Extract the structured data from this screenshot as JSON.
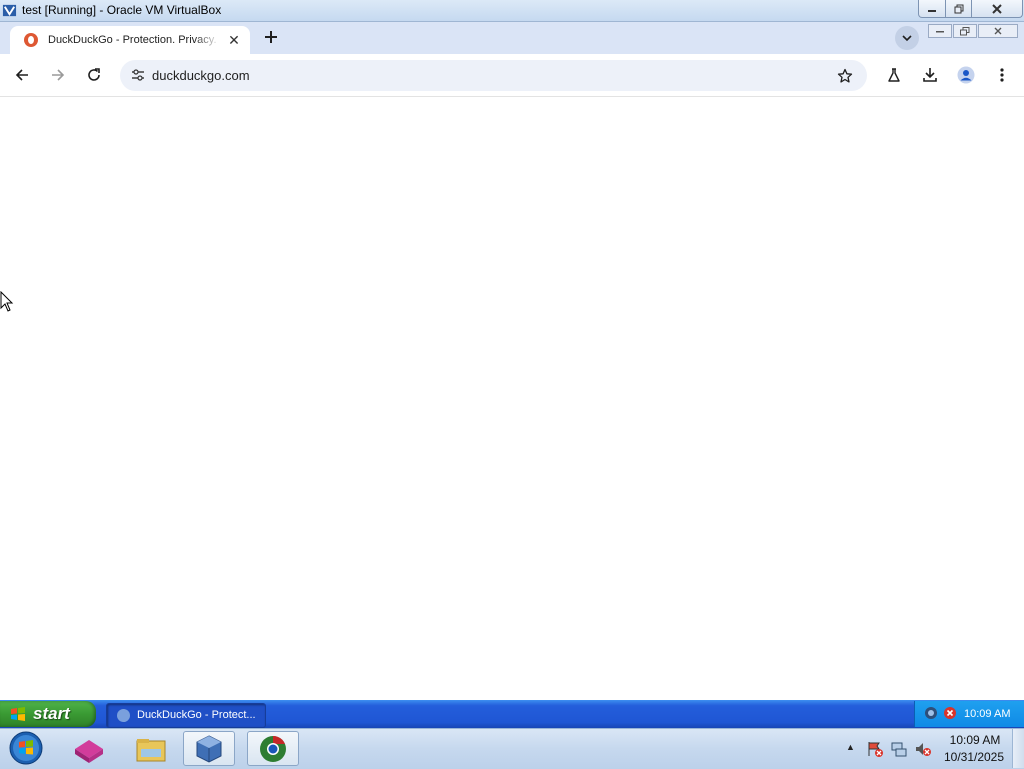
{
  "host_window": {
    "title": "test [Running] - Oracle VM VirtualBox"
  },
  "browser": {
    "tab": {
      "title": "DuckDuckGo - Protection. Privacy. Peace of mind.",
      "favicon": "duckduckgo-icon"
    },
    "url": "duckduckgo.com",
    "toolbar_icons": [
      "back-icon",
      "forward-icon",
      "reload-icon",
      "site-info-icon",
      "bookmark-star-icon",
      "labs-flask-icon",
      "download-icon",
      "profile-icon",
      "menu-icon"
    ]
  },
  "guest_taskbar": {
    "start_label": "start",
    "task_label": "DuckDuckGo - Protect...",
    "clock": "10:09 AM"
  },
  "host_taskbar": {
    "time": "10:09 AM",
    "date": "10/31/2025",
    "pinned": [
      "windows-start-orb",
      "app-icon-pink-box",
      "file-explorer-icon",
      "virtualbox-icon",
      "chrome-icon"
    ]
  },
  "colors": {
    "tabstrip": "#dae4f6",
    "omnibox": "#edf1f9",
    "xp_taskbar": "#245edb",
    "xp_start": "#3a9a33",
    "duckduckgo_orange": "#de5833"
  }
}
